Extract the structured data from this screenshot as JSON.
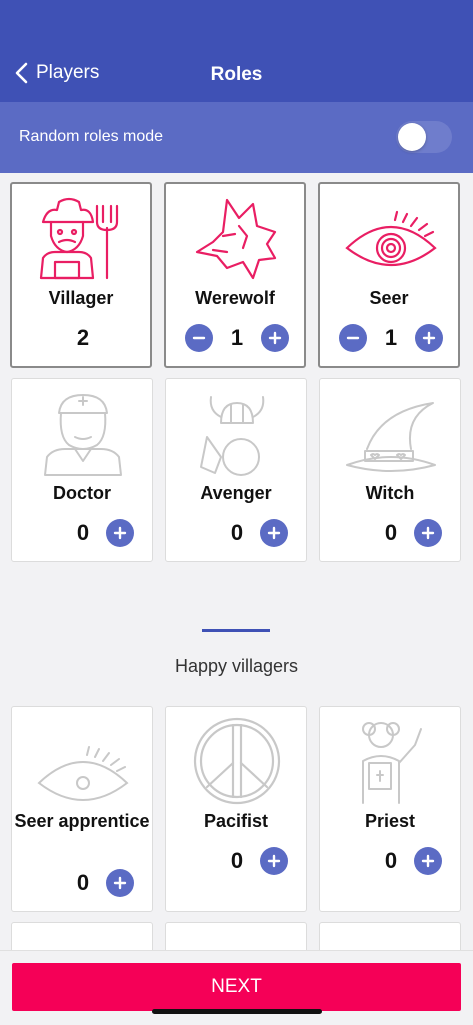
{
  "nav": {
    "back_label": "Players",
    "title": "Roles"
  },
  "random_roles": {
    "label": "Random roles mode",
    "enabled": false
  },
  "roles": [
    {
      "name": "Villager",
      "count": "2",
      "selected": true
    },
    {
      "name": "Werewolf",
      "count": "1",
      "selected": true
    },
    {
      "name": "Seer",
      "count": "1",
      "selected": true
    },
    {
      "name": "Doctor",
      "count": "0",
      "selected": false
    },
    {
      "name": "Avenger",
      "count": "0",
      "selected": false
    },
    {
      "name": "Witch",
      "count": "0",
      "selected": false
    }
  ],
  "section": {
    "title": "Happy villagers"
  },
  "happy_roles": [
    {
      "name": "Seer apprentice",
      "count": "0"
    },
    {
      "name": "Pacifist",
      "count": "0"
    },
    {
      "name": "Priest",
      "count": "0"
    }
  ],
  "footer": {
    "next_label": "NEXT"
  },
  "colors": {
    "header": "#3f51b5",
    "accent": "#5b6bc4",
    "next": "#f50057",
    "selected_icon": "#e91e63",
    "disabled_icon": "#c8c8c8"
  }
}
